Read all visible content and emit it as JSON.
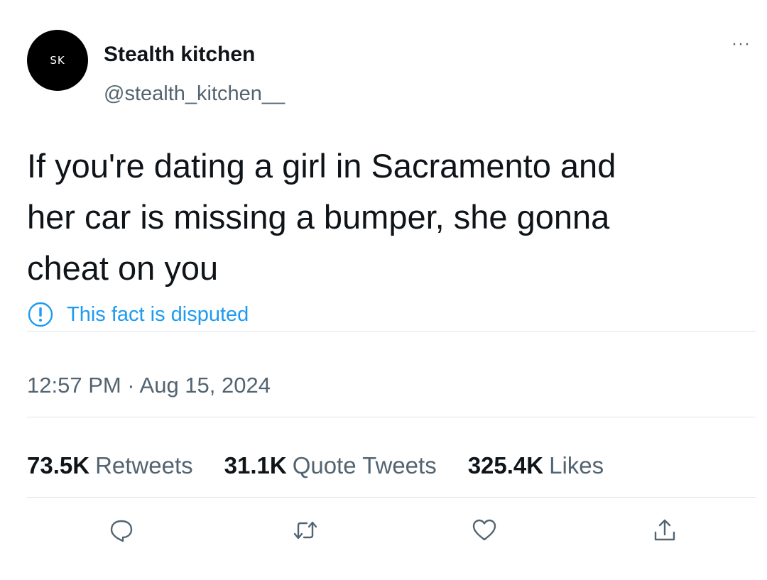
{
  "author": {
    "avatar_text": "SK",
    "display_name": "Stealth kitchen",
    "handle": "@stealth_kitchen__"
  },
  "more_menu": {
    "icon": "more-dots-icon",
    "label": "···"
  },
  "tweet": {
    "text": "If you're dating a girl in Sacramento and\nher car is missing a bumper, she gonna\ncheat on you",
    "notice": {
      "icon": "info-alert-icon",
      "text": "This fact is disputed"
    },
    "timestamp": "12:57 PM · Aug 15, 2024"
  },
  "stats": [
    {
      "count": "73.5K",
      "label": "Retweets"
    },
    {
      "count": "31.1K",
      "label": "Quote Tweets"
    },
    {
      "count": "325.4K",
      "label": "Likes"
    }
  ],
  "actions": [
    {
      "icon": "reply-icon"
    },
    {
      "icon": "retweet-icon"
    },
    {
      "icon": "like-heart-icon"
    },
    {
      "icon": "share-icon"
    }
  ],
  "colors": {
    "text": "#0f1419",
    "secondary_text": "#536471",
    "accent": "#1d9bf0",
    "divider": "#dfe4e8"
  }
}
